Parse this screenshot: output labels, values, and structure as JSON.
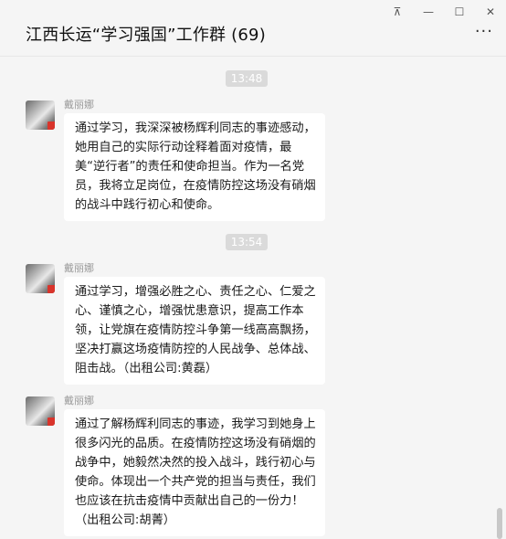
{
  "window": {
    "title": "江西长运“学习强国”工作群 (69)",
    "controls": {
      "pin": "⊼",
      "minimize": "—",
      "maximize": "☐",
      "close": "✕"
    },
    "more": "···"
  },
  "chat": {
    "messages": [
      {
        "timestamp": "13:48",
        "sender": "戴丽娜",
        "text": "通过学习，我深深被杨辉利同志的事迹感动，她用自己的实际行动诠释着面对疫情，最美“逆行者”的责任和使命担当。作为一名党员，我将立足岗位，在疫情防控这场没有硝烟的战斗中践行初心和使命。"
      },
      {
        "timestamp": "13:54",
        "sender": "戴丽娜",
        "text": "通过学习，增强必胜之心、责任之心、仁爱之心、谨慎之心，增强忧患意识，提高工作本领，让党旗在疫情防控斗争第一线高高飘扬，坚决打赢这场疫情防控的人民战争、总体战、阻击战。（出租公司:黄磊）"
      },
      {
        "sender": "戴丽娜",
        "text": "通过了解杨辉利同志的事迹，我学习到她身上很多闪光的品质。在疫情防控这场没有硝烟的战争中，她毅然决然的投入战斗，践行初心与使命。体现出一个共产党的担当与责任，我们也应该在抗击疫情中贡献出自己的一份力！（出租公司:胡菁）"
      }
    ]
  },
  "colors": {
    "background": "#f5f5f5",
    "bubble": "#ffffff",
    "timestamp_bg": "#dadada",
    "badge": "#d9342b"
  },
  "icons": {
    "pin": "pin-icon",
    "minimize": "minimize-icon",
    "maximize": "maximize-icon",
    "close": "close-icon",
    "more": "more-icon"
  }
}
